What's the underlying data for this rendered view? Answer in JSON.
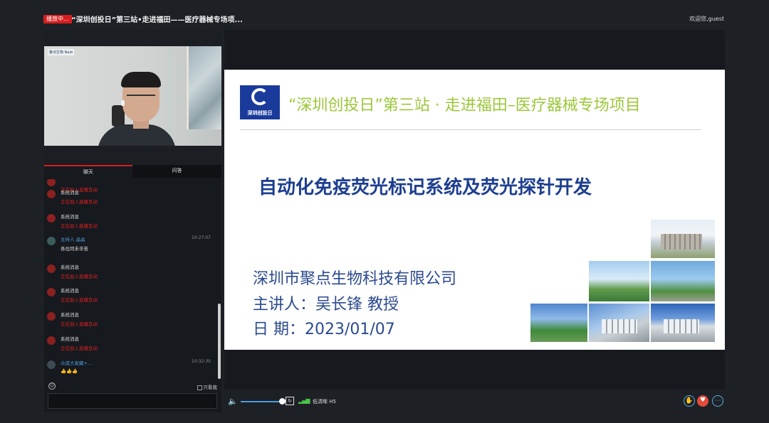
{
  "header": {
    "live_badge": "播放中...",
    "title": "“深圳创投日”第三站•走进福田——医疗器械专场项...",
    "welcome": "欢迎您,guest"
  },
  "webcam": {
    "logo_text": "聚点生物 Next"
  },
  "tabs": {
    "chat": "聊天",
    "qa": "问答"
  },
  "chat": {
    "messages": [
      {
        "type": "system",
        "name": "",
        "text": "正在加入直播互动"
      },
      {
        "type": "system",
        "name": "系统消息",
        "text": "正在加入直播互动"
      },
      {
        "type": "system",
        "name": "系统消息",
        "text": "正在加入直播互动"
      },
      {
        "type": "host",
        "name": "主持人 晶晶",
        "text": "各位同未辛苦",
        "time": "10:27:07"
      },
      {
        "type": "system",
        "name": "系统消息",
        "text": "正在加入直播互动"
      },
      {
        "type": "system",
        "name": "系统消息",
        "text": "正在加入直播互动"
      },
      {
        "type": "system",
        "name": "系统消息",
        "text": "正在加入直播互动"
      },
      {
        "type": "system",
        "name": "系统消息",
        "text": "正在加入直播互动"
      },
      {
        "type": "audience",
        "name": "众成大家藏+...",
        "text": "👍👍👍",
        "time": "10:32:30"
      }
    ],
    "only_me": "只看我",
    "input_value": ""
  },
  "slide": {
    "logo_text": "深圳创投日",
    "header": "“深圳创投日”第三站 · 走进福田–医疗器械专场项目",
    "title": "自动化免疫荧光标记系统及荧光探针开发",
    "company": "深圳市聚点生物科技有限公司",
    "speaker": "主讲人：吴长锋  教授",
    "date": "日    期：2023/01/07"
  },
  "controls": {
    "quality": "低清晰 H5",
    "volume_level": 0.9
  },
  "colors": {
    "accent_red": "#d71d1d",
    "slide_green": "#9cc73a",
    "slide_blue": "#1e3f8f",
    "link_blue": "#4a9de0"
  }
}
